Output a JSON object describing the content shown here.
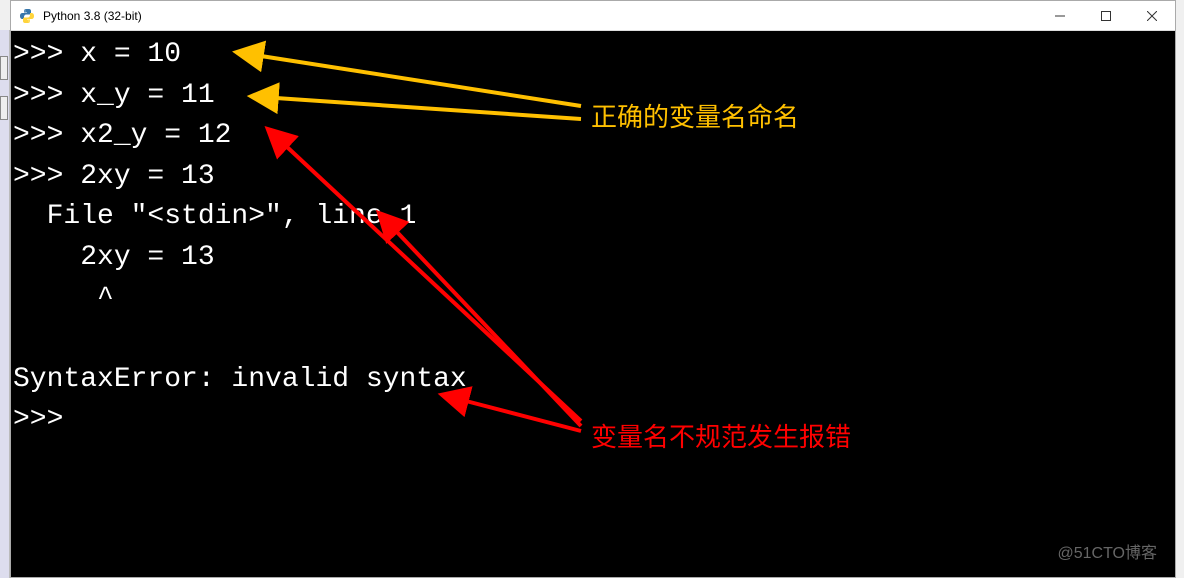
{
  "window": {
    "title": "Python 3.8 (32-bit)"
  },
  "terminal": {
    "lines": {
      "l1": ">>> x = 10",
      "l2": ">>> x_y = 11",
      "l3": ">>> x2_y = 12",
      "l4": ">>> 2xy = 13",
      "l5": "  File \"<stdin>\", line 1",
      "l6": "    2xy = 13",
      "l7": "     ^",
      "l8": "SyntaxError: invalid syntax",
      "l9": ">>>"
    }
  },
  "annotations": {
    "correct": "正确的变量名命名",
    "error": "变量名不规范发生报错"
  },
  "watermark": "@51CTO博客",
  "colors": {
    "arrow_yellow": "#ffc000",
    "arrow_red": "#ff0000",
    "terminal_bg": "#000000",
    "terminal_fg": "#ffffff"
  }
}
